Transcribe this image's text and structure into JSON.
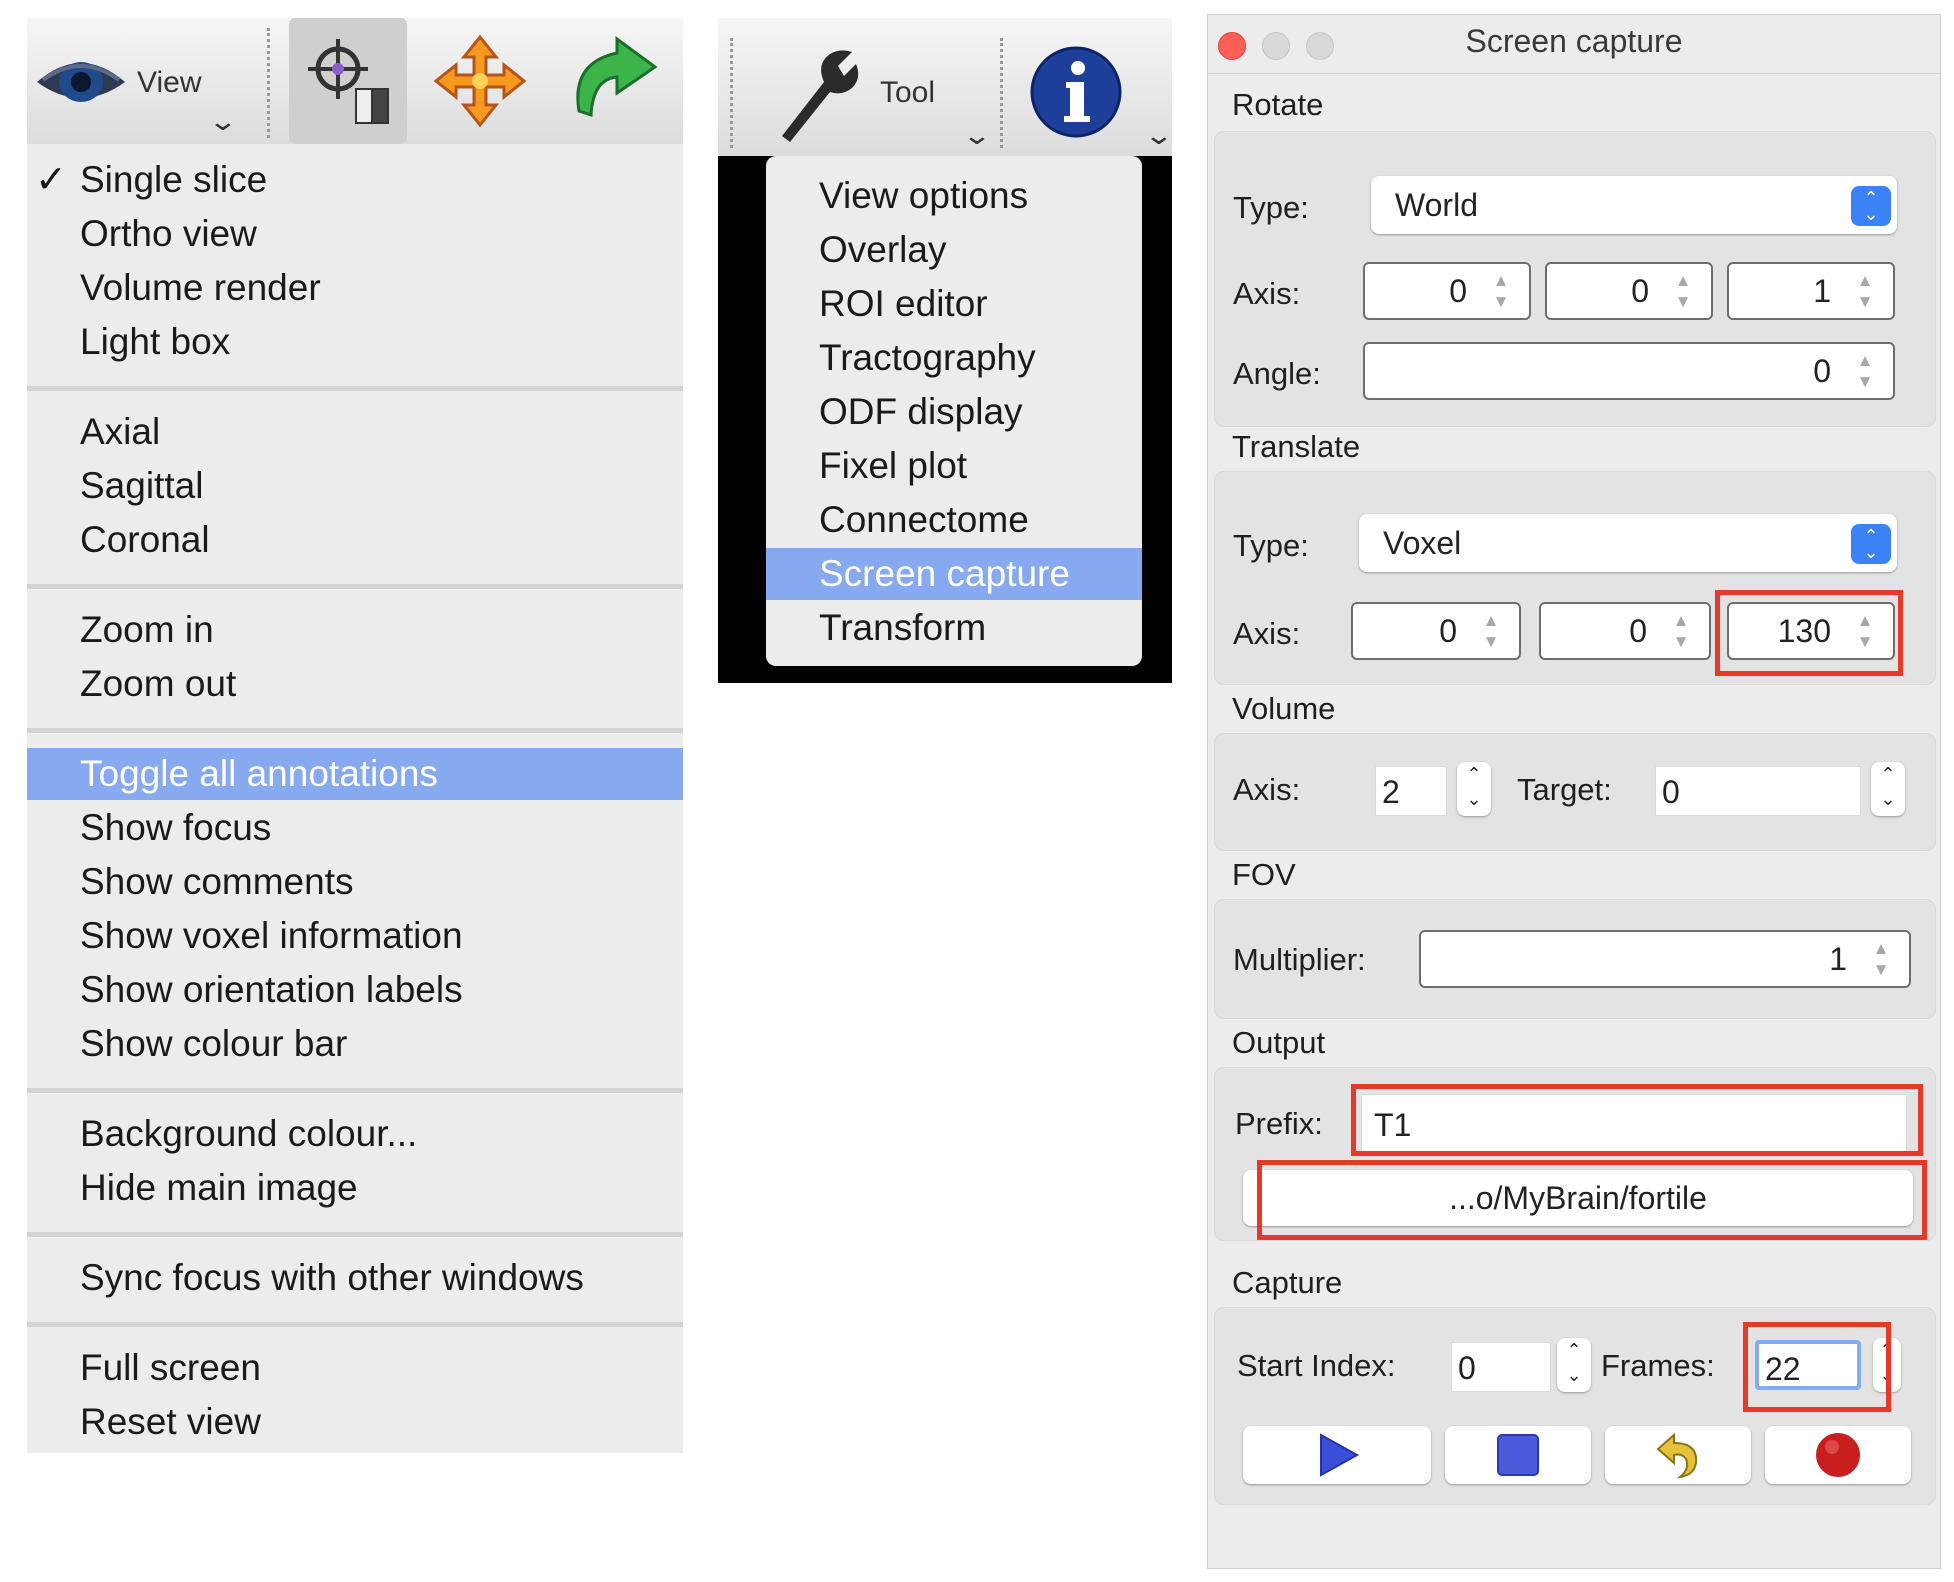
{
  "view_toolbar": {
    "view_label": "View"
  },
  "view_menu": {
    "groups": [
      [
        "Single slice",
        "Ortho view",
        "Volume render",
        "Light box"
      ],
      [
        "Axial",
        "Sagittal",
        "Coronal"
      ],
      [
        "Zoom in",
        "Zoom out"
      ],
      [
        "Toggle all annotations",
        "Show focus",
        "Show comments",
        "Show voxel information",
        "Show orientation labels",
        "Show colour bar"
      ],
      [
        "Background colour...",
        "Hide main image"
      ],
      [
        "Sync focus with other windows"
      ],
      [
        "Full screen",
        "Reset view"
      ]
    ],
    "checked_item": "Single slice",
    "highlighted_item": "Toggle all annotations",
    "check_mark": "✓"
  },
  "tool_toolbar": {
    "tool_label": "Tool"
  },
  "tool_menu": {
    "items": [
      "View options",
      "Overlay",
      "ROI editor",
      "Tractography",
      "ODF display",
      "Fixel plot",
      "Connectome",
      "Screen capture",
      "Transform"
    ],
    "highlighted_item": "Screen capture"
  },
  "dialog": {
    "title": "Screen capture",
    "rotate": {
      "section": "Rotate",
      "type_label": "Type:",
      "type_value": "World",
      "axis_label": "Axis:",
      "axis_values": [
        "0",
        "0",
        "1"
      ],
      "angle_label": "Angle:",
      "angle_value": "0"
    },
    "translate": {
      "section": "Translate",
      "type_label": "Type:",
      "type_value": "Voxel",
      "axis_label": "Axis:",
      "axis_values": [
        "0",
        "0",
        "130"
      ]
    },
    "volume": {
      "section": "Volume",
      "axis_label": "Axis:",
      "axis_value": "2",
      "target_label": "Target:",
      "target_value": "0"
    },
    "fov": {
      "section": "FOV",
      "multiplier_label": "Multiplier:",
      "multiplier_value": "1"
    },
    "output": {
      "section": "Output",
      "prefix_label": "Prefix:",
      "prefix_value": "T1",
      "folder_button": "...o/MyBrain/fortile"
    },
    "capture": {
      "section": "Capture",
      "start_index_label": "Start Index:",
      "start_index_value": "0",
      "frames_label": "Frames:",
      "frames_value": "22"
    }
  },
  "colors": {
    "highlight": "#86a9f0",
    "annotation_red": "#e53a2a",
    "combo_blue": "#3b82f6",
    "traffic_close": "#ff5f57"
  },
  "icons": [
    "eye-icon",
    "crosshair-icon",
    "move-icon",
    "rotate-icon",
    "wrench-icon",
    "info-icon",
    "play-icon",
    "stop-icon",
    "undo-icon",
    "record-icon"
  ]
}
